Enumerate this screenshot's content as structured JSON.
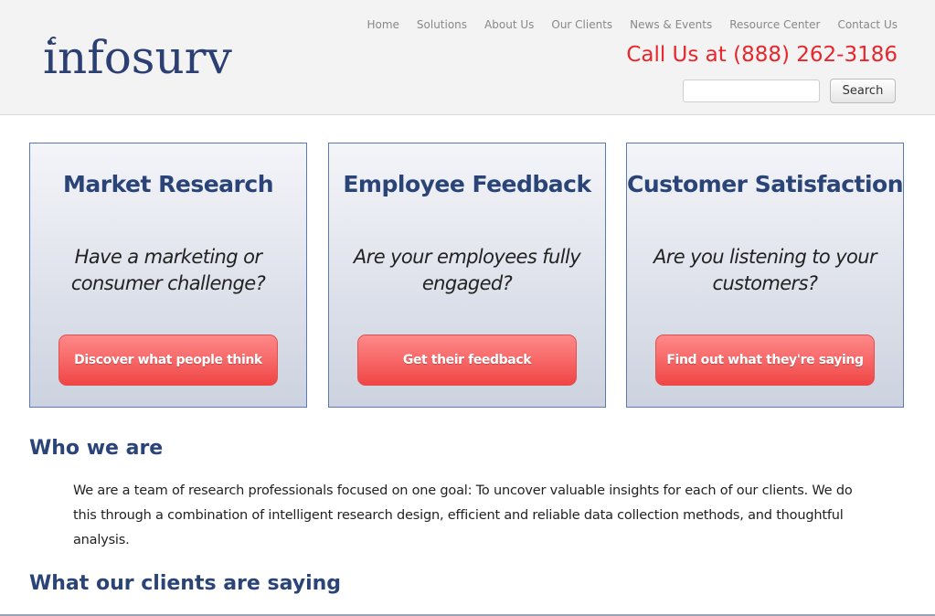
{
  "header": {
    "logo_text": "infosurv",
    "nav": [
      "Home",
      "Solutions",
      "About Us",
      "Our Clients",
      "News & Events",
      "Resource Center",
      "Contact Us"
    ],
    "phone": "Call Us at (888) 262-3186",
    "search": {
      "value": "",
      "placeholder": "",
      "button_label": "Search"
    }
  },
  "cards": [
    {
      "title": "Market Research",
      "question": "Have a marketing or consumer challenge?",
      "button": "Discover what people think"
    },
    {
      "title": "Employee Feedback",
      "question": "Are your employees fully engaged?",
      "button": "Get their feedback"
    },
    {
      "title": "Customer Satisfaction",
      "question": "Are you listening to your customers?",
      "button": "Find out what they're saying"
    }
  ],
  "who_we_are": {
    "heading": "Who we are",
    "text": "We are a team of research professionals focused on one goal: To uncover valuable insights for each of our clients. We do this through a combination of intelligent research design, efficient and reliable data collection methods, and thoughtful analysis."
  },
  "testimonials": {
    "heading": "What our clients are saying"
  },
  "colors": {
    "brand_blue": "#2a4478",
    "phone_red": "#e8262b",
    "button_red": "#f04545",
    "header_bg": "#f3f3f3"
  }
}
